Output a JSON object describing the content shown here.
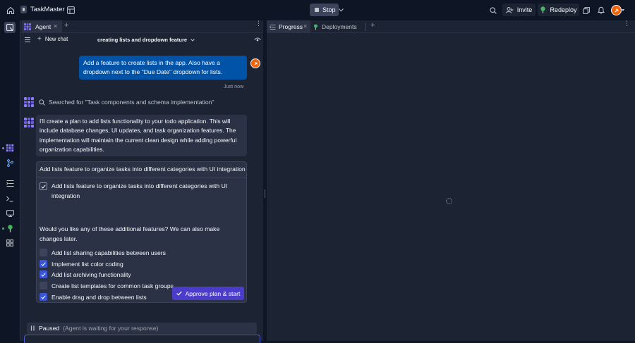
{
  "topbar": {
    "app_name": "TaskMaster",
    "stop_label": "Stop",
    "invite_label": "Invite",
    "redeploy_label": "Redeploy"
  },
  "left_tabs": {
    "agent_label": "Agent"
  },
  "chat_header": {
    "new_chat_label": "New chat",
    "title": "creating lists and dropdown feature"
  },
  "user_message": {
    "text": "Add a feature to create lists in the app. Also have a dropdown next to the \"Due Date\" dropdown for lists.",
    "timestamp": "Just now"
  },
  "search_status": "Searched for \"Task components and schema implementation\"",
  "agent_message": "I'll create a plan to add lists functionality to your todo application. This will include database changes, UI updates, and task organization features. The implementation will maintain the current clean design while adding powerful organization capabilities.",
  "plan": {
    "title": "Add lists feature to organize tasks into different categories with UI integration",
    "main_item": "Add lists feature to organize tasks into different categories with UI integration",
    "question": "Would you like any of these additional features? We can also make changes later.",
    "options": [
      {
        "label": "Add list sharing capabilities between users",
        "checked": false
      },
      {
        "label": "Implement list color coding",
        "checked": true
      },
      {
        "label": "Add list archiving functionality",
        "checked": true
      },
      {
        "label": "Create list templates for common task groups",
        "checked": false
      },
      {
        "label": "Enable drag and drop between lists",
        "checked": true
      }
    ],
    "approve_label": "Approve plan & start"
  },
  "paused": {
    "label": "Paused",
    "detail": "(Agent is waiting for your response)"
  },
  "right_tabs": {
    "progress_label": "Progress",
    "deployments_label": "Deployments"
  },
  "colors": {
    "accent": "#4b3cc9",
    "user_bubble": "#0053a6",
    "checkbox_on": "#3a56d8",
    "avatar": "#f26207"
  }
}
